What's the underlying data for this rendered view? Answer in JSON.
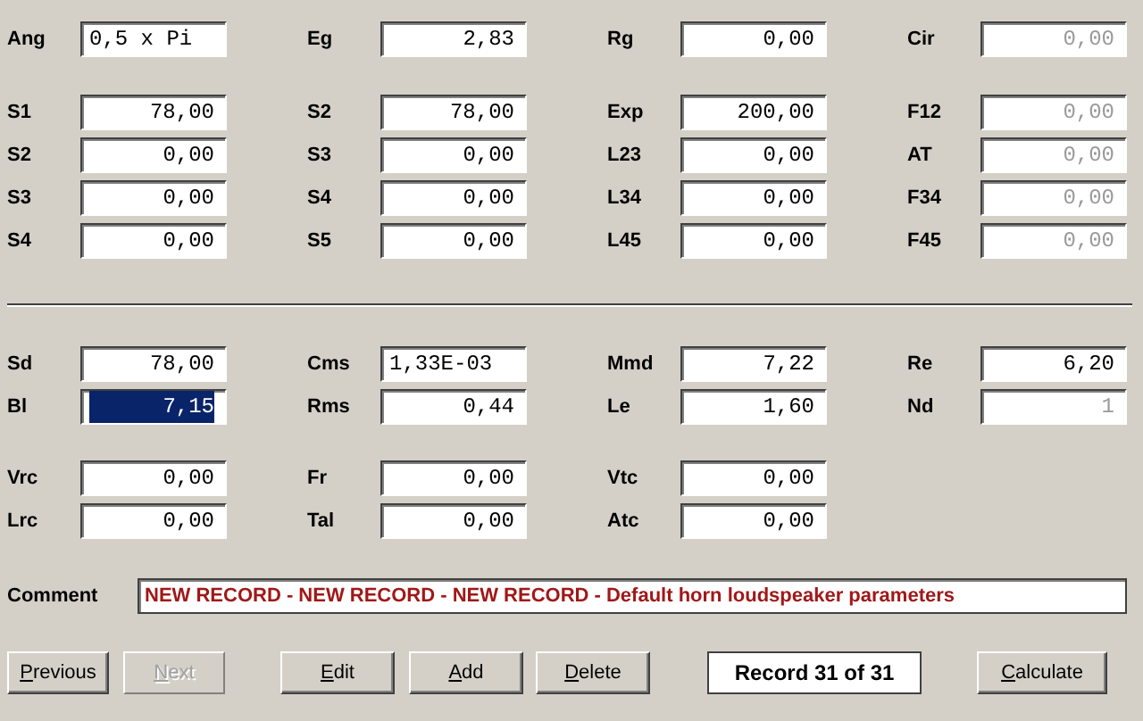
{
  "upper": [
    {
      "rows": [
        [
          {
            "label": "Ang",
            "value": "0,5 x Pi",
            "left_aligned": true,
            "disabled": false,
            "selected": false
          },
          {
            "label": "Eg",
            "value": "2,83",
            "left_aligned": false,
            "disabled": false,
            "selected": false
          },
          {
            "label": "Rg",
            "value": "0,00",
            "left_aligned": false,
            "disabled": false,
            "selected": false
          },
          {
            "label": "Cir",
            "value": "0,00",
            "left_aligned": false,
            "disabled": true,
            "selected": false
          }
        ]
      ]
    },
    {
      "rows": [
        [
          {
            "label": "S1",
            "value": "78,00",
            "left_aligned": false,
            "disabled": false,
            "selected": false
          },
          {
            "label": "S2",
            "value": "78,00",
            "left_aligned": false,
            "disabled": false,
            "selected": false
          },
          {
            "label": "Exp",
            "value": "200,00",
            "left_aligned": false,
            "disabled": false,
            "selected": false
          },
          {
            "label": "F12",
            "value": "0,00",
            "left_aligned": false,
            "disabled": true,
            "selected": false
          }
        ],
        [
          {
            "label": "S2",
            "value": "0,00",
            "left_aligned": false,
            "disabled": false,
            "selected": false
          },
          {
            "label": "S3",
            "value": "0,00",
            "left_aligned": false,
            "disabled": false,
            "selected": false
          },
          {
            "label": "L23",
            "value": "0,00",
            "left_aligned": false,
            "disabled": false,
            "selected": false
          },
          {
            "label": "AT",
            "value": "0,00",
            "left_aligned": false,
            "disabled": true,
            "selected": false
          }
        ],
        [
          {
            "label": "S3",
            "value": "0,00",
            "left_aligned": false,
            "disabled": false,
            "selected": false
          },
          {
            "label": "S4",
            "value": "0,00",
            "left_aligned": false,
            "disabled": false,
            "selected": false
          },
          {
            "label": "L34",
            "value": "0,00",
            "left_aligned": false,
            "disabled": false,
            "selected": false
          },
          {
            "label": "F34",
            "value": "0,00",
            "left_aligned": false,
            "disabled": true,
            "selected": false
          }
        ],
        [
          {
            "label": "S4",
            "value": "0,00",
            "left_aligned": false,
            "disabled": false,
            "selected": false
          },
          {
            "label": "S5",
            "value": "0,00",
            "left_aligned": false,
            "disabled": false,
            "selected": false
          },
          {
            "label": "L45",
            "value": "0,00",
            "left_aligned": false,
            "disabled": false,
            "selected": false
          },
          {
            "label": "F45",
            "value": "0,00",
            "left_aligned": false,
            "disabled": true,
            "selected": false
          }
        ]
      ]
    }
  ],
  "lower": [
    {
      "rows": [
        [
          {
            "label": "Sd",
            "value": "78,00",
            "left_aligned": false,
            "disabled": false,
            "selected": false
          },
          {
            "label": "Cms",
            "value": "1,33E-03",
            "left_aligned": true,
            "disabled": false,
            "selected": false
          },
          {
            "label": "Mmd",
            "value": "7,22",
            "left_aligned": false,
            "disabled": false,
            "selected": false
          },
          {
            "label": "Re",
            "value": "6,20",
            "left_aligned": false,
            "disabled": false,
            "selected": false
          }
        ],
        [
          {
            "label": "Bl",
            "value": "7,15",
            "left_aligned": false,
            "disabled": false,
            "selected": true
          },
          {
            "label": "Rms",
            "value": "0,44",
            "left_aligned": false,
            "disabled": false,
            "selected": false
          },
          {
            "label": "Le",
            "value": "1,60",
            "left_aligned": false,
            "disabled": false,
            "selected": false
          },
          {
            "label": "Nd",
            "value": "1",
            "left_aligned": false,
            "disabled": true,
            "selected": false
          }
        ]
      ]
    },
    {
      "rows": [
        [
          {
            "label": "Vrc",
            "value": "0,00",
            "left_aligned": false,
            "disabled": false,
            "selected": false
          },
          {
            "label": "Fr",
            "value": "0,00",
            "left_aligned": false,
            "disabled": false,
            "selected": false
          },
          {
            "label": "Vtc",
            "value": "0,00",
            "left_aligned": false,
            "disabled": false,
            "selected": false
          }
        ],
        [
          {
            "label": "Lrc",
            "value": "0,00",
            "left_aligned": false,
            "disabled": false,
            "selected": false
          },
          {
            "label": "Tal",
            "value": "0,00",
            "left_aligned": false,
            "disabled": false,
            "selected": false
          },
          {
            "label": "Atc",
            "value": "0,00",
            "left_aligned": false,
            "disabled": false,
            "selected": false
          }
        ]
      ]
    }
  ],
  "comment": {
    "label": "Comment",
    "value": "NEW RECORD - NEW RECORD - NEW RECORD - Default horn loudspeaker parameters"
  },
  "buttons": [
    {
      "label": "Previous",
      "disabled": false,
      "kind": "button"
    },
    {
      "label": "Next",
      "disabled": true,
      "kind": "button"
    },
    {
      "label": "Edit",
      "disabled": false,
      "kind": "button"
    },
    {
      "label": "Add",
      "disabled": false,
      "kind": "button"
    },
    {
      "label": "Delete",
      "disabled": false,
      "kind": "button"
    },
    {
      "label": "Record 31 of 31",
      "kind": "counter"
    },
    {
      "label": "Calculate",
      "disabled": false,
      "kind": "button"
    }
  ]
}
